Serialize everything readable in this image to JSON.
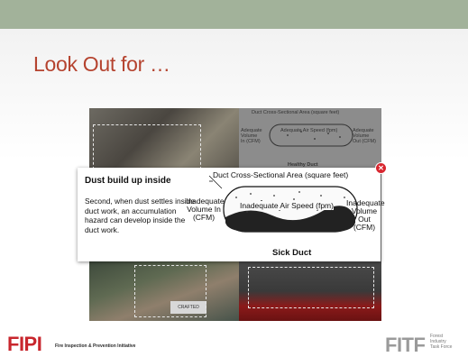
{
  "slide": {
    "title": "Look Out for …"
  },
  "popup": {
    "title": "Dust build up inside",
    "body": "Second, when dust settles inside duct work, an accumulation hazard can develop inside the duct work.",
    "close_icon": "close-icon"
  },
  "sick_duct": {
    "area_label": "Duct Cross-Sectional Area (square feet)",
    "in_label": "Inadequate Volume In (CFM)",
    "speed_label": "Inadequate Air Speed (fpm)",
    "out_label": "Inadequate Volume Out (CFM)",
    "caption": "Sick Duct"
  },
  "healthy_duct": {
    "area_label": "Duct Cross-Sectional Area (square feet)",
    "in_label": "Adequate Volume In (CFM)",
    "speed_label": "Adequate Air Speed (fpm)",
    "out_label": "Adequate Volume Out (CFM)",
    "caption": "Healthy Duct"
  },
  "photo_text": {
    "crafted_label": "CRAFTED"
  },
  "footer": {
    "fipi_logo": "FIPI",
    "fipi_tagline": "Fire Inspection & Prevention Initiative",
    "fitf_logo": "FITF",
    "fitf_line1": "Forest",
    "fitf_line2": "Industry",
    "fitf_line3": "Task Force"
  },
  "colors": {
    "top_bar": "#a2b29a",
    "title": "#b5432f",
    "close": "#d8262f",
    "fipi": "#c8262d"
  }
}
